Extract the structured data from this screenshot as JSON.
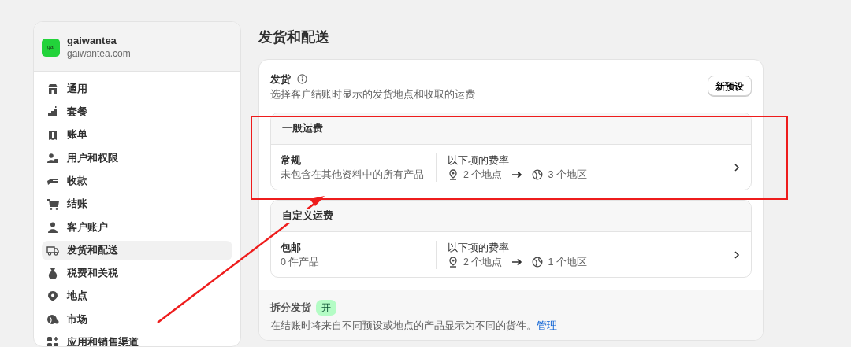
{
  "store": {
    "logo": "gai",
    "name": "gaiwantea",
    "domain": "gaiwantea.com"
  },
  "sidebar": {
    "items": [
      {
        "label": "通用",
        "selected": false
      },
      {
        "label": "套餐",
        "selected": false
      },
      {
        "label": "账单",
        "selected": false
      },
      {
        "label": "用户和权限",
        "selected": false
      },
      {
        "label": "收款",
        "selected": false
      },
      {
        "label": "结账",
        "selected": false
      },
      {
        "label": "客户账户",
        "selected": false
      },
      {
        "label": "发货和配送",
        "selected": true
      },
      {
        "label": "税费和关税",
        "selected": false
      },
      {
        "label": "地点",
        "selected": false
      },
      {
        "label": "市场",
        "selected": false
      },
      {
        "label": "应用和销售渠道",
        "selected": false
      }
    ]
  },
  "page_title": "发货和配送",
  "shipping": {
    "title": "发货",
    "description": "选择客户结账时显示的发货地点和收取的运费",
    "button": "新预设",
    "profiles": [
      {
        "title": "一般运费",
        "name": "常规",
        "summary": "未包含在其他资料中的所有产品",
        "rates_label": "以下项的费率",
        "locations": "2 个地点",
        "zones": "3 个地区"
      },
      {
        "title": "自定义运费",
        "name": "包邮",
        "summary": "0 件产品",
        "rates_label": "以下项的费率",
        "locations": "2 个地点",
        "zones": "1 个地区"
      }
    ]
  },
  "split_shipping": {
    "title": "拆分发货",
    "badge": "开",
    "on": true,
    "text": "在结账时将来自不同预设或地点的产品显示为不同的货件。",
    "link": "管理"
  }
}
